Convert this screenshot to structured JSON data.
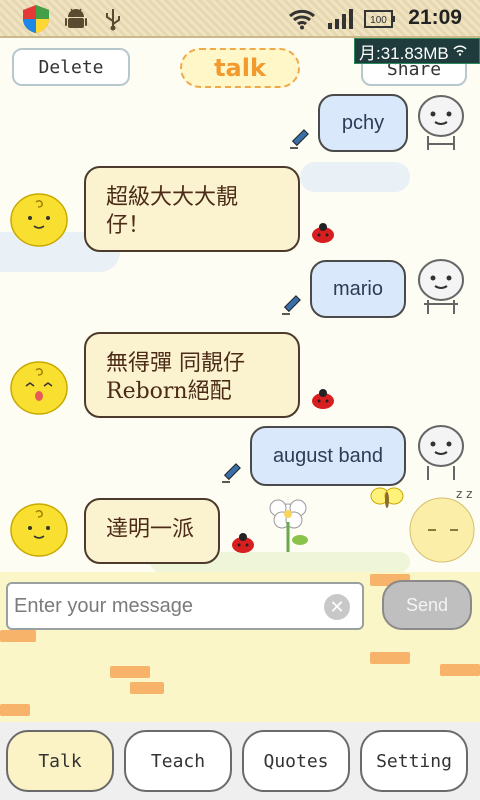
{
  "status_bar": {
    "time": "21:09",
    "battery": "100"
  },
  "header": {
    "delete_label": "Delete",
    "title": "talk",
    "share_label": "Share",
    "network_badge": "月:31.83MB"
  },
  "messages": [
    {
      "side": "right",
      "text": "pchy"
    },
    {
      "side": "left",
      "text": "超級大大大靚仔！"
    },
    {
      "side": "right",
      "text": "mario"
    },
    {
      "side": "left",
      "text": "無得彈 同靚仔Reborn絕配"
    },
    {
      "side": "right",
      "text": "august band"
    },
    {
      "side": "left",
      "text": "達明一派"
    }
  ],
  "input": {
    "placeholder": "Enter your message",
    "send_label": "Send"
  },
  "tabs": [
    {
      "label": "Talk"
    },
    {
      "label": "Teach"
    },
    {
      "label": "Quotes"
    },
    {
      "label": "Setting"
    }
  ],
  "colors": {
    "right_bubble": "#d9e8fb",
    "left_bubble": "#fbf3d0",
    "title_accent": "#f29a2e",
    "send_disabled": "#bfbfbf"
  }
}
